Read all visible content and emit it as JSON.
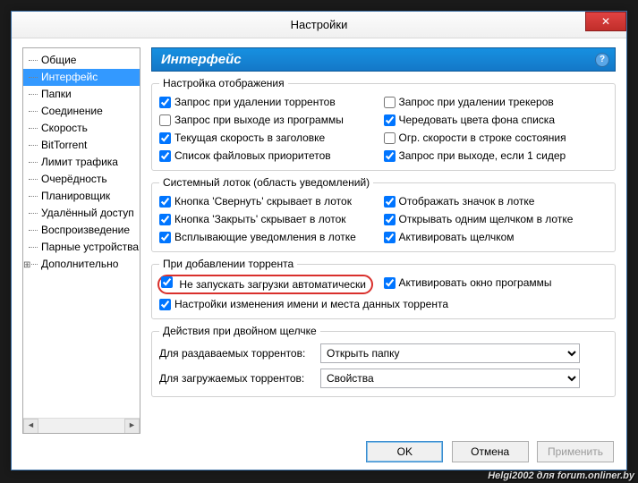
{
  "window": {
    "title": "Настройки",
    "close": "✕"
  },
  "tree": {
    "items": [
      "Общие",
      "Интерфейс",
      "Папки",
      "Соединение",
      "Скорость",
      "BitTorrent",
      "Лимит трафика",
      "Очерёдность",
      "Планировщик",
      "Удалённый доступ",
      "Воспроизведение",
      "Парные устройства",
      "Дополнительно"
    ],
    "selected_index": 1,
    "expandable_index": 12
  },
  "header": {
    "title": "Интерфейс",
    "help": "?"
  },
  "group1": {
    "legend": "Настройка отображения",
    "left": [
      {
        "label": "Запрос при удалении торрентов",
        "checked": true
      },
      {
        "label": "Запрос при выходе из программы",
        "checked": false
      },
      {
        "label": "Текущая скорость в заголовке",
        "checked": true
      },
      {
        "label": "Список файловых приоритетов",
        "checked": true
      }
    ],
    "right": [
      {
        "label": "Запрос при удалении трекеров",
        "checked": false
      },
      {
        "label": "Чередовать цвета фона списка",
        "checked": true
      },
      {
        "label": "Огр. скорости в строке состояния",
        "checked": false
      },
      {
        "label": "Запрос при выходе, если 1 сидер",
        "checked": true
      }
    ]
  },
  "group2": {
    "legend": "Системный лоток (область уведомлений)",
    "left": [
      {
        "label": "Кнопка 'Свернуть' скрывает в лоток",
        "checked": true
      },
      {
        "label": "Кнопка 'Закрыть' скрывает в лоток",
        "checked": true
      },
      {
        "label": "Всплывающие уведомления в лотке",
        "checked": true
      }
    ],
    "right": [
      {
        "label": "Отображать значок в лотке",
        "checked": true
      },
      {
        "label": "Открывать одним щелчком в лотке",
        "checked": true
      },
      {
        "label": "Активировать щелчком",
        "checked": true
      }
    ]
  },
  "group3": {
    "legend": "При добавлении торрента",
    "row1_left": {
      "label": "Не запускать загрузки автоматически",
      "checked": true
    },
    "row1_right": {
      "label": "Активировать окно программы",
      "checked": true
    },
    "row2": {
      "label": "Настройки изменения имени и места данных торрента",
      "checked": true
    }
  },
  "group4": {
    "legend": "Действия при двойном щелчке",
    "row1_label": "Для раздаваемых торрентов:",
    "row1_value": "Открыть папку",
    "row2_label": "Для загружаемых торрентов:",
    "row2_value": "Свойства"
  },
  "buttons": {
    "ok": "OK",
    "cancel": "Отмена",
    "apply": "Применить"
  },
  "watermark": "Helgi2002 для forum.onliner.by"
}
